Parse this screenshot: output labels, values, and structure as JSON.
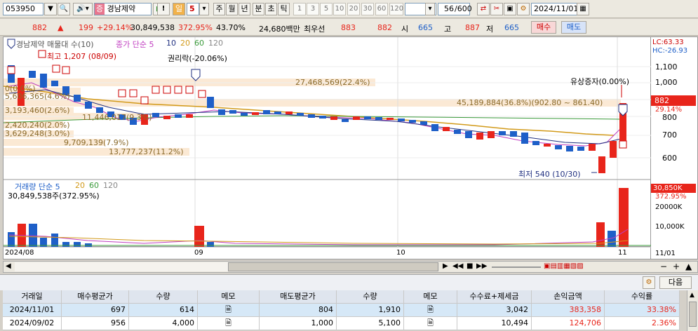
{
  "toolbar": {
    "code": "053950",
    "stock_tag": "증",
    "stock_name": "경남제약",
    "warn": "!",
    "period_label": "일",
    "period_value": "5",
    "periods": [
      "주",
      "월",
      "년",
      "분",
      "초",
      "틱"
    ],
    "numbers": [
      "1",
      "3",
      "5",
      "10",
      "20",
      "30",
      "60",
      "120"
    ],
    "count": "56",
    "count_total": "/600",
    "date": "2024/11/01"
  },
  "info": {
    "price": "882",
    "change": "199",
    "change_pct": "+29.14%",
    "volume": "30,849,538",
    "volume_pct": "372.95%",
    "rate": "43.70%",
    "value": "24,680백만",
    "best_label": "최우선",
    "best_ask": "883",
    "best_bid": "882",
    "open_label": "시",
    "open": "665",
    "high_label": "고",
    "high": "887",
    "low_label": "저",
    "low": "665",
    "buy_label": "매수",
    "sell_label": "매도"
  },
  "chart": {
    "legend_name": "경남제약 매물대 수(10)",
    "legend_ma": "종가 단순 5",
    "ma_periods": [
      "10",
      "20",
      "60",
      "120"
    ],
    "high_note": "최고 1,207 (08/09)",
    "rights_note": "권리락(-20.06%)",
    "capital_note": "유상증자(0.00%)",
    "low_note": "최저 540 (10/30)",
    "lc": "LC:63.33",
    "hc": "HC:-26.93",
    "price_ticks": [
      "1,100",
      "1,000",
      "900",
      "800",
      "700",
      "600"
    ],
    "cur_price": "882",
    "cur_pct": "29.14%",
    "vp_labels": [
      "27,468,569(22.4%)",
      "45,189,884(36.8%)(902.80 ~ 861.40)",
      "0(0.0%)",
      "5,606,365(4.6%)",
      "3,193,460(2.6%)",
      "11,446,017(9.3%)",
      "2,420,240(2.0%)",
      "3,629,248(3.0%)",
      "9,709,139(7.9%)",
      "13,777,237(11.2%)"
    ],
    "vol_legend": "거래량 단순 5",
    "vol_ma": [
      "20",
      "60",
      "120"
    ],
    "vol_value": "30,849,538주(372.95%)",
    "vol_ticks": [
      "20000K",
      "10,000K"
    ],
    "vol_cur": "30,850K",
    "vol_pct": "372.95%",
    "x_labels": [
      "2024/08",
      "09",
      "10",
      "11",
      "11/01"
    ]
  },
  "chart_data": {
    "type": "candlestick",
    "x_labels": [
      "2024/08",
      "09",
      "10",
      "11"
    ],
    "ylim": [
      520,
      1220
    ],
    "candles_note": "daily OHLC approx",
    "last": {
      "date": "2024/11/01",
      "open": 665,
      "high": 887,
      "low": 665,
      "close": 882,
      "volume": 30849538
    }
  },
  "next_label": "다음",
  "table": {
    "headers": [
      "거래일",
      "매수평균가",
      "수량",
      "메모",
      "매도평균가",
      "수량",
      "메모",
      "수수료+제세금",
      "손익금액",
      "수익률"
    ],
    "rows": [
      [
        "2024/11/01",
        "697",
        "614",
        "",
        "804",
        "1,910",
        "",
        "3,042",
        "383,358",
        "33.38%"
      ],
      [
        "2024/09/02",
        "956",
        "4,000",
        "",
        "1,000",
        "5,100",
        "",
        "10,494",
        "124,706",
        "2.36%"
      ]
    ]
  },
  "colors": {
    "up": "#e8251b",
    "down": "#1e5fc8",
    "accent": "#cc0000"
  }
}
